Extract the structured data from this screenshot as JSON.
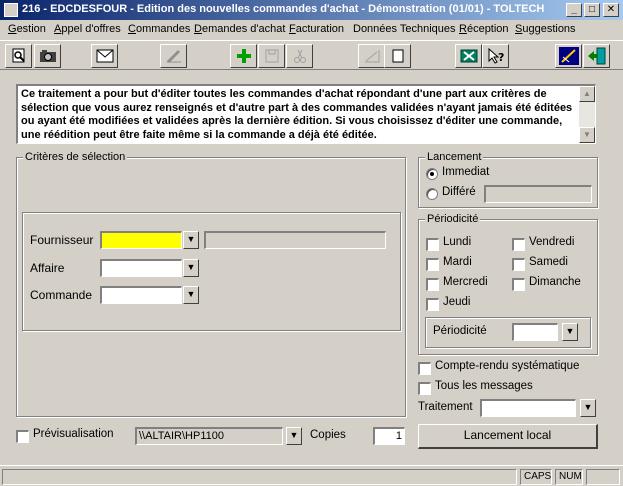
{
  "window": {
    "title": "216 - EDCDESFOUR - Edition des nouvelles commandes d'achat - Démonstration (01/01) - TOLTECH",
    "minimize_glyph": "_",
    "maximize_glyph": "□",
    "close_glyph": "✕"
  },
  "menu": [
    {
      "label": "Gestion",
      "u": "G",
      "rest": "estion"
    },
    {
      "label": "Appel d'offres",
      "u": "A",
      "rest": "ppel d'offres"
    },
    {
      "label": "Commandes",
      "u": "C",
      "rest": "ommandes"
    },
    {
      "label": "Demandes d'achat",
      "u": "D",
      "rest": "emandes d'achat"
    },
    {
      "label": "Facturation",
      "u": "F",
      "rest": "acturation"
    },
    {
      "label": "Données Techniques",
      "u": "",
      "rest": "Données Techniques"
    },
    {
      "label": "Réception",
      "u": "R",
      "rest": "éception"
    },
    {
      "label": "Suggestions",
      "u": "S",
      "rest": "uggestions"
    }
  ],
  "description": "Ce traitement a pour but d'éditer toutes les commandes d'achat répondant d'une part aux critères de sélection que vous aurez renseignés et d'autre part à des commandes validées n'ayant jamais été éditées ou ayant été modifiées et validées après la dernière édition. Si vous choisissez d'éditer une commande, une réédition peut être faite même si la commande a déjà été éditée.",
  "criteria": {
    "group_label": "Critères de sélection",
    "fournisseur_label": "Fournisseur",
    "fournisseur_value": "",
    "fournisseur_name": "",
    "affaire_label": "Affaire",
    "affaire_value": "",
    "commande_label": "Commande",
    "commande_value": ""
  },
  "lancement": {
    "group_label": "Lancement",
    "immediat_label": "Immediat",
    "differe_label": "Différé",
    "differe_value": "",
    "selected": "immediat"
  },
  "periodicite": {
    "group_label": "Périodicité",
    "days": [
      {
        "label": "Lundi",
        "checked": false
      },
      {
        "label": "Vendredi",
        "checked": false
      },
      {
        "label": "Mardi",
        "checked": false
      },
      {
        "label": "Samedi",
        "checked": false
      },
      {
        "label": "Mercredi",
        "checked": false
      },
      {
        "label": "Dimanche",
        "checked": false
      },
      {
        "label": "Jeudi",
        "checked": false
      }
    ],
    "select_label": "Périodicité",
    "select_value": ""
  },
  "options": {
    "compte_rendu_label": "Compte-rendu systématique",
    "tous_messages_label": "Tous les messages",
    "traitement_label": "Traitement",
    "traitement_value": ""
  },
  "preview": {
    "label": "Prévisualisation",
    "printer": "\\\\ALTAIR\\HP1100",
    "copies_label": "Copies",
    "copies_value": "1"
  },
  "launch_button": "Lancement local",
  "status": {
    "caps": "CAPS",
    "num": "NUM"
  },
  "dropdown_glyph": "▼",
  "colors": {
    "titlebar_start": "#0a246a",
    "titlebar_end": "#a6caf0",
    "window_bg": "#d4d0c8",
    "required_field": "#ffff00"
  }
}
